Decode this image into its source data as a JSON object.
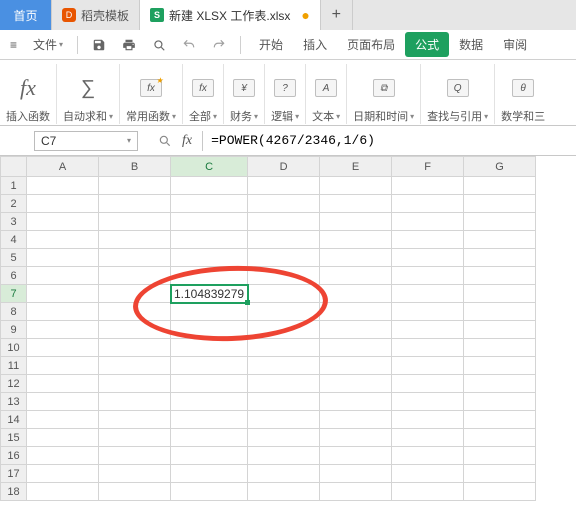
{
  "tabs": {
    "home": "首页",
    "templates": "稻壳模板",
    "active_doc": "新建 XLSX 工作表.xlsx"
  },
  "menu": {
    "file": "文件",
    "items": [
      "开始",
      "插入",
      "页面布局",
      "公式",
      "数据",
      "审阅"
    ],
    "active_idx": 3
  },
  "ribbon": {
    "insert_fn": "插入函数",
    "autosum": "自动求和",
    "common": "常用函数",
    "all": "全部",
    "financial": "财务",
    "logical": "逻辑",
    "text": "文本",
    "datetime": "日期和时间",
    "lookup": "查找与引用",
    "math": "数学和三"
  },
  "namebox": "C7",
  "formula": "=POWER(4267/2346,1/6)",
  "columns": [
    "A",
    "B",
    "C",
    "D",
    "E",
    "F",
    "G"
  ],
  "row_count": 18,
  "active_col_idx": 2,
  "active_row": 7,
  "cell_value": "1.104839279",
  "chart_data": {
    "type": "table",
    "active_cell": "C7",
    "formula": "=POWER(4267/2346,1/6)",
    "result": 1.104839279
  }
}
